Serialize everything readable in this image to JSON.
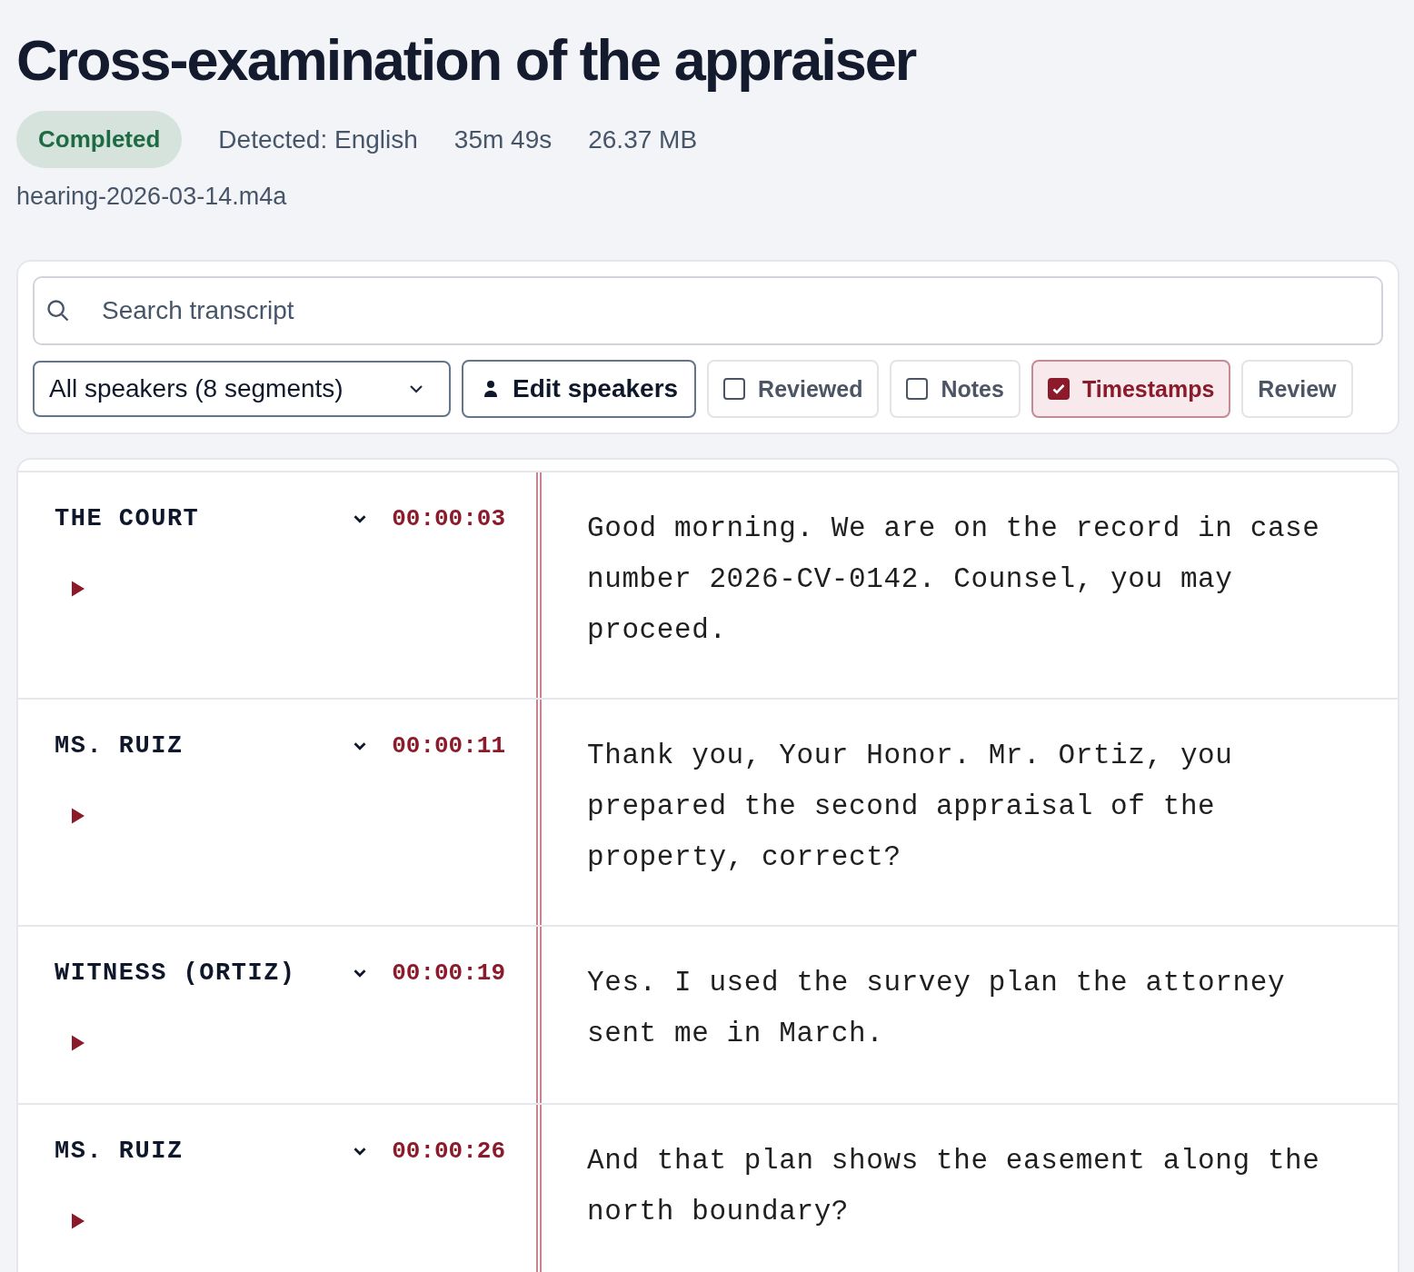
{
  "title": "Cross-examination of the appraiser",
  "meta": {
    "status": "Completed",
    "language": "Detected: English",
    "duration": "35m 49s",
    "size": "26.37 MB",
    "filename": "hearing-2026-03-14.m4a"
  },
  "search": {
    "placeholder": "Search transcript"
  },
  "speaker_filter": {
    "value": "All speakers (8 segments)"
  },
  "edit_speakers": "Edit speakers",
  "toggles": [
    {
      "label": "Reviewed",
      "checked": false
    },
    {
      "label": "Notes",
      "checked": false
    },
    {
      "label": "Timestamps",
      "checked": true
    }
  ],
  "review_button": "Review",
  "segments": [
    {
      "speaker": "THE COURT",
      "time": "00:00:03",
      "text": "Good morning. We are on the record in case number 2026-CV-0142. Counsel, you may proceed."
    },
    {
      "speaker": "MS. RUIZ",
      "time": "00:00:11",
      "text": "Thank you, Your Honor. Mr. Ortiz, you prepared the second appraisal of the property, correct?"
    },
    {
      "speaker": "WITNESS (ORTIZ)",
      "time": "00:00:19",
      "text": "Yes. I used the survey plan the attorney sent me in March."
    },
    {
      "speaker": "MS. RUIZ",
      "time": "00:00:26",
      "text": "And that plan shows the easement along the north boundary?"
    }
  ]
}
